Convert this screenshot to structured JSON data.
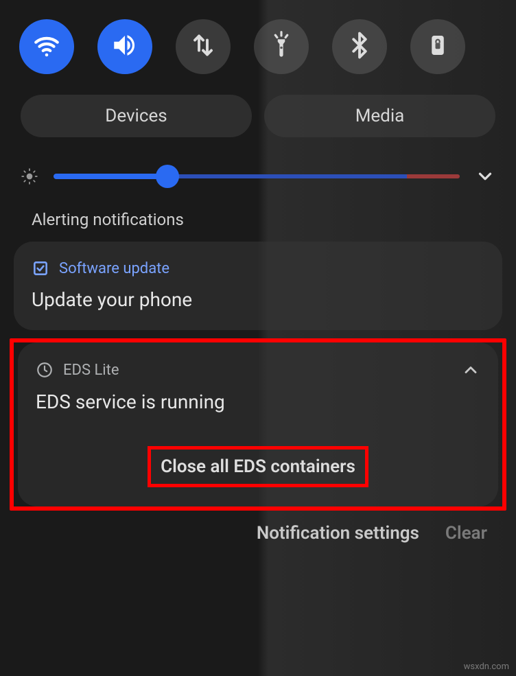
{
  "qs": {
    "devices_label": "Devices",
    "media_label": "Media"
  },
  "section_label": "Alerting notifications",
  "notifications": [
    {
      "app_name": "Software update",
      "title": "Update your phone"
    },
    {
      "app_name": "EDS Lite",
      "title": "EDS service is running",
      "action_label": "Close all EDS containers"
    }
  ],
  "footer": {
    "settings_label": "Notification settings",
    "clear_label": "Clear"
  },
  "watermark": "wsxdn.com"
}
